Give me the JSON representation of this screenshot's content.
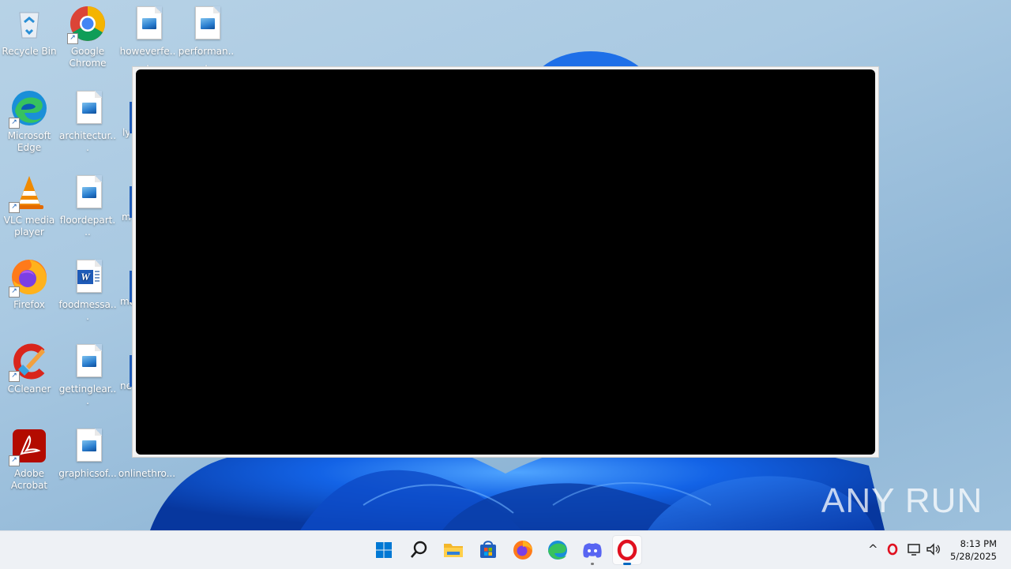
{
  "desktop": {
    "icons": [
      {
        "label": "Recycle Bin",
        "icon": "recycle-bin-icon"
      },
      {
        "label": "Google Chrome",
        "icon": "chrome-icon"
      },
      {
        "label": "howeverfe...",
        "icon": "image-file-icon"
      },
      {
        "label": "performan...",
        "icon": "image-file-icon"
      },
      {
        "label": "Microsoft Edge",
        "icon": "edge-icon"
      },
      {
        "label": "architectur...",
        "icon": "image-file-icon"
      },
      {
        "label": "ly",
        "icon": "word-file-icon"
      },
      {
        "label": "VLC media player",
        "icon": "vlc-icon"
      },
      {
        "label": "floordepart...",
        "icon": "image-file-icon"
      },
      {
        "label": "m",
        "icon": "word-file-icon"
      },
      {
        "label": "Firefox",
        "icon": "firefox-icon"
      },
      {
        "label": "foodmessa...",
        "icon": "word-file-icon"
      },
      {
        "label": "me",
        "icon": "word-file-icon"
      },
      {
        "label": "CCleaner",
        "icon": "ccleaner-icon"
      },
      {
        "label": "gettinglear...",
        "icon": "image-file-icon"
      },
      {
        "label": "ne",
        "icon": "word-file-icon"
      },
      {
        "label": "Adobe Acrobat",
        "icon": "acrobat-icon"
      },
      {
        "label": "graphicsof...",
        "icon": "image-file-icon"
      },
      {
        "label": "onlinethro...",
        "icon": "file-icon"
      }
    ]
  },
  "watermark": "ANY RUN",
  "taskbar": {
    "apps": [
      {
        "name": "Start",
        "icon": "windows-start-icon"
      },
      {
        "name": "Search",
        "icon": "search-icon"
      },
      {
        "name": "File Explorer",
        "icon": "folder-icon"
      },
      {
        "name": "Microsoft Store",
        "icon": "store-icon"
      },
      {
        "name": "Firefox",
        "icon": "firefox-icon"
      },
      {
        "name": "Microsoft Edge",
        "icon": "edge-icon"
      },
      {
        "name": "Discord",
        "icon": "discord-icon"
      },
      {
        "name": "Opera",
        "icon": "opera-icon"
      }
    ],
    "tray": {
      "chevron": "^",
      "time": "8:13 PM",
      "date": "5/28/2025"
    }
  },
  "colors": {
    "accent": "#0067c0",
    "window_content": "#000000"
  }
}
